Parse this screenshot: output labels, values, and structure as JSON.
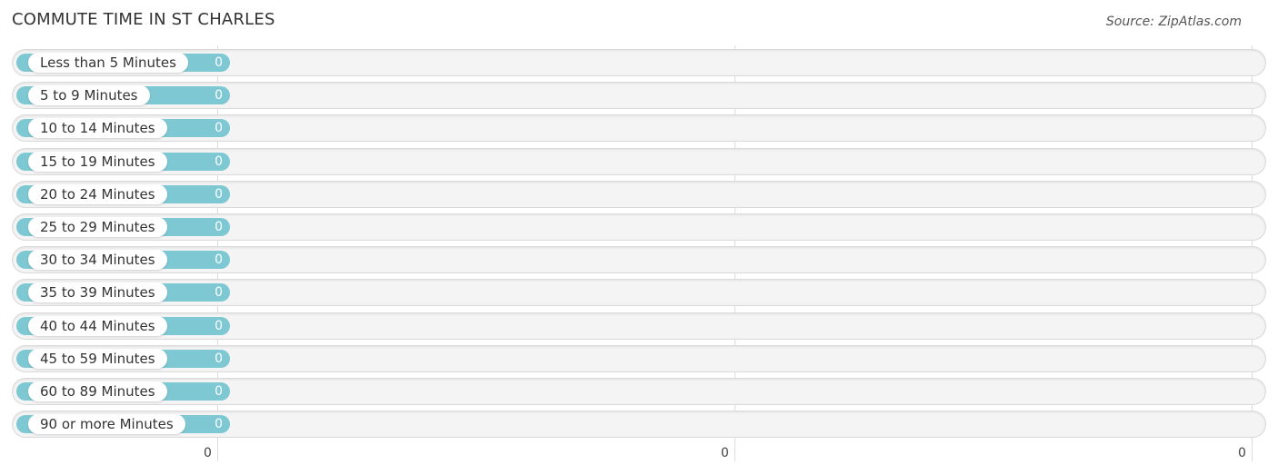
{
  "header": {
    "title": "COMMUTE TIME IN ST CHARLES",
    "source": "Source: ZipAtlas.com"
  },
  "chart_data": {
    "type": "bar",
    "orientation": "horizontal",
    "title": "COMMUTE TIME IN ST CHARLES",
    "categories": [
      "Less than 5 Minutes",
      "5 to 9 Minutes",
      "10 to 14 Minutes",
      "15 to 19 Minutes",
      "20 to 24 Minutes",
      "25 to 29 Minutes",
      "30 to 34 Minutes",
      "35 to 39 Minutes",
      "40 to 44 Minutes",
      "45 to 59 Minutes",
      "60 to 89 Minutes",
      "90 or more Minutes"
    ],
    "values": [
      0,
      0,
      0,
      0,
      0,
      0,
      0,
      0,
      0,
      0,
      0,
      0
    ],
    "value_labels": [
      "0",
      "0",
      "0",
      "0",
      "0",
      "0",
      "0",
      "0",
      "0",
      "0",
      "0",
      "0"
    ],
    "x_tick_labels": [
      "0",
      "0",
      "0"
    ],
    "xlabel": "",
    "ylabel": "",
    "grid": true,
    "bar_color": "#7ec8d3"
  }
}
